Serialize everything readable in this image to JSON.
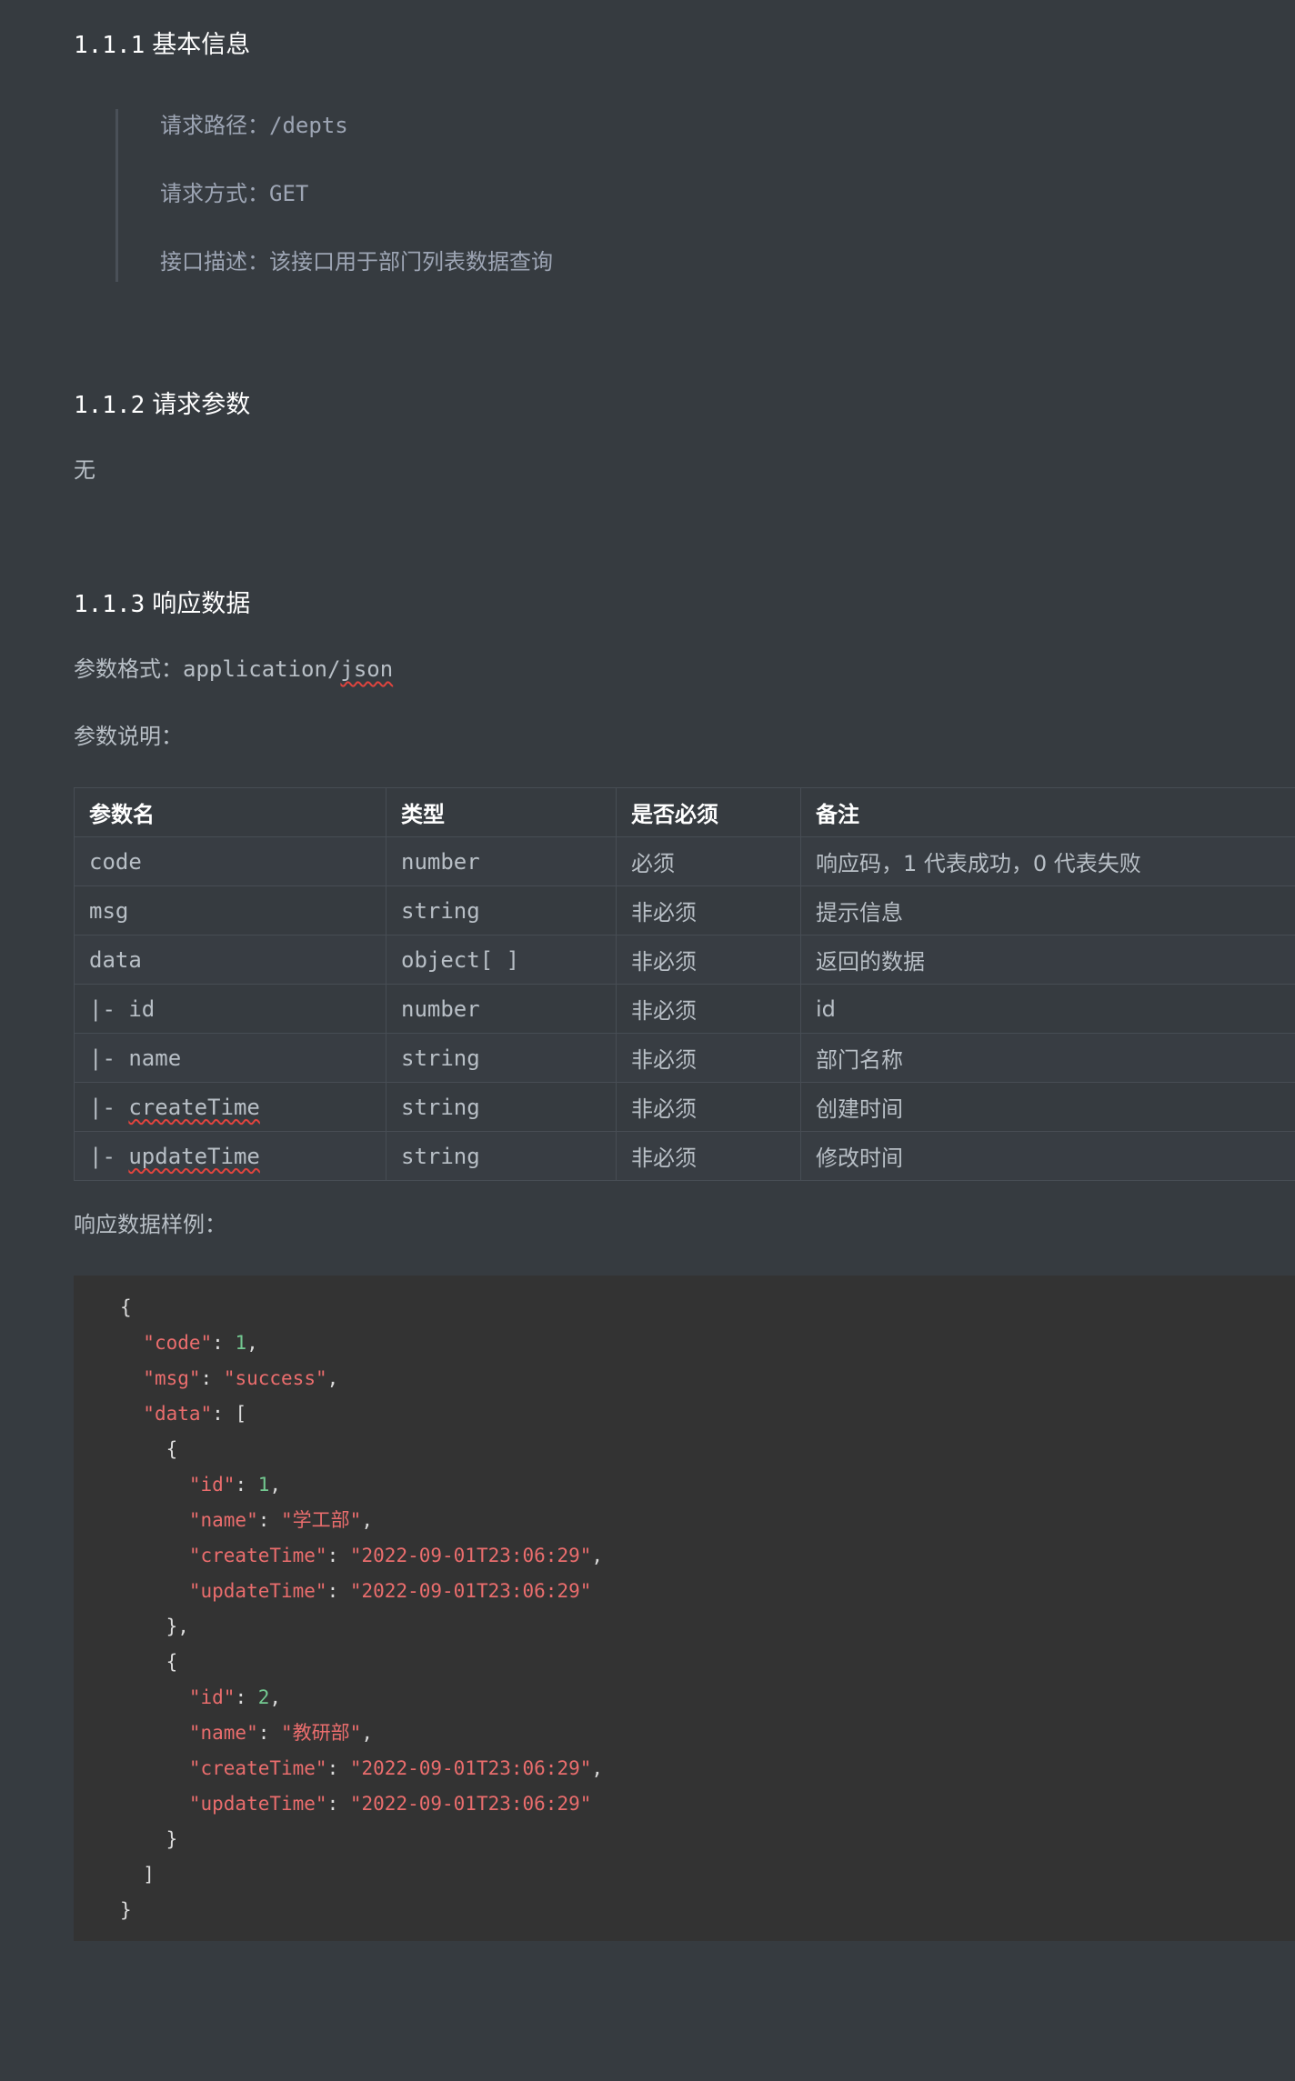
{
  "section_basic": {
    "num": "1.1.1",
    "title": "基本信息"
  },
  "basic_info": {
    "path_label": "请求路径：",
    "path_value": "/depts",
    "method_label": "请求方式：",
    "method_value": "GET",
    "desc_label": "接口描述：",
    "desc_value": "该接口用于部门列表数据查询"
  },
  "section_params": {
    "num": "1.1.2",
    "title": "请求参数"
  },
  "request_params_text": "无",
  "section_response": {
    "num": "1.1.3",
    "title": "响应数据"
  },
  "response": {
    "format_label": "参数格式：",
    "format_value_pre": "application/",
    "format_value_json": "json",
    "desc_label": "参数说明：",
    "example_label": "响应数据样例："
  },
  "table": {
    "headers": [
      "参数名",
      "类型",
      "是否必须",
      "备注"
    ],
    "rows": [
      {
        "name_prefix": "",
        "name": "code",
        "type": "number",
        "required": "必须",
        "note": "响应码，1 代表成功，0 代表失败"
      },
      {
        "name_prefix": "",
        "name": "msg",
        "type": "string",
        "required": "非必须",
        "note": "提示信息"
      },
      {
        "name_prefix": "",
        "name": "data",
        "type": "object[ ]",
        "required": "非必须",
        "note": "返回的数据"
      },
      {
        "name_prefix": "|- ",
        "name": "id",
        "type": "number",
        "required": "非必须",
        "note": "id"
      },
      {
        "name_prefix": "|- ",
        "name": "name",
        "type": "string",
        "required": "非必须",
        "note": "部门名称"
      },
      {
        "name_prefix": "|- ",
        "name": "createTime",
        "type": "string",
        "required": "非必须",
        "note": "创建时间"
      },
      {
        "name_prefix": "|- ",
        "name": "updateTime",
        "type": "string",
        "required": "非必须",
        "note": "修改时间"
      }
    ]
  },
  "code_example": {
    "code_key": "\"code\"",
    "code_val": "1",
    "msg_key": "\"msg\"",
    "msg_val": "\"success\"",
    "data_key": "\"data\"",
    "items": [
      {
        "id_key": "\"id\"",
        "id_val": "1",
        "name_key": "\"name\"",
        "name_val": "\"学工部\"",
        "ct_key": "\"createTime\"",
        "ct_val": "\"2022-09-01T23:06:29\"",
        "ut_key": "\"updateTime\"",
        "ut_val": "\"2022-09-01T23:06:29\""
      },
      {
        "id_key": "\"id\"",
        "id_val": "2",
        "name_key": "\"name\"",
        "name_val": "\"教研部\"",
        "ct_key": "\"createTime\"",
        "ct_val": "\"2022-09-01T23:06:29\"",
        "ut_key": "\"updateTime\"",
        "ut_val": "\"2022-09-01T23:06:29\""
      }
    ]
  }
}
